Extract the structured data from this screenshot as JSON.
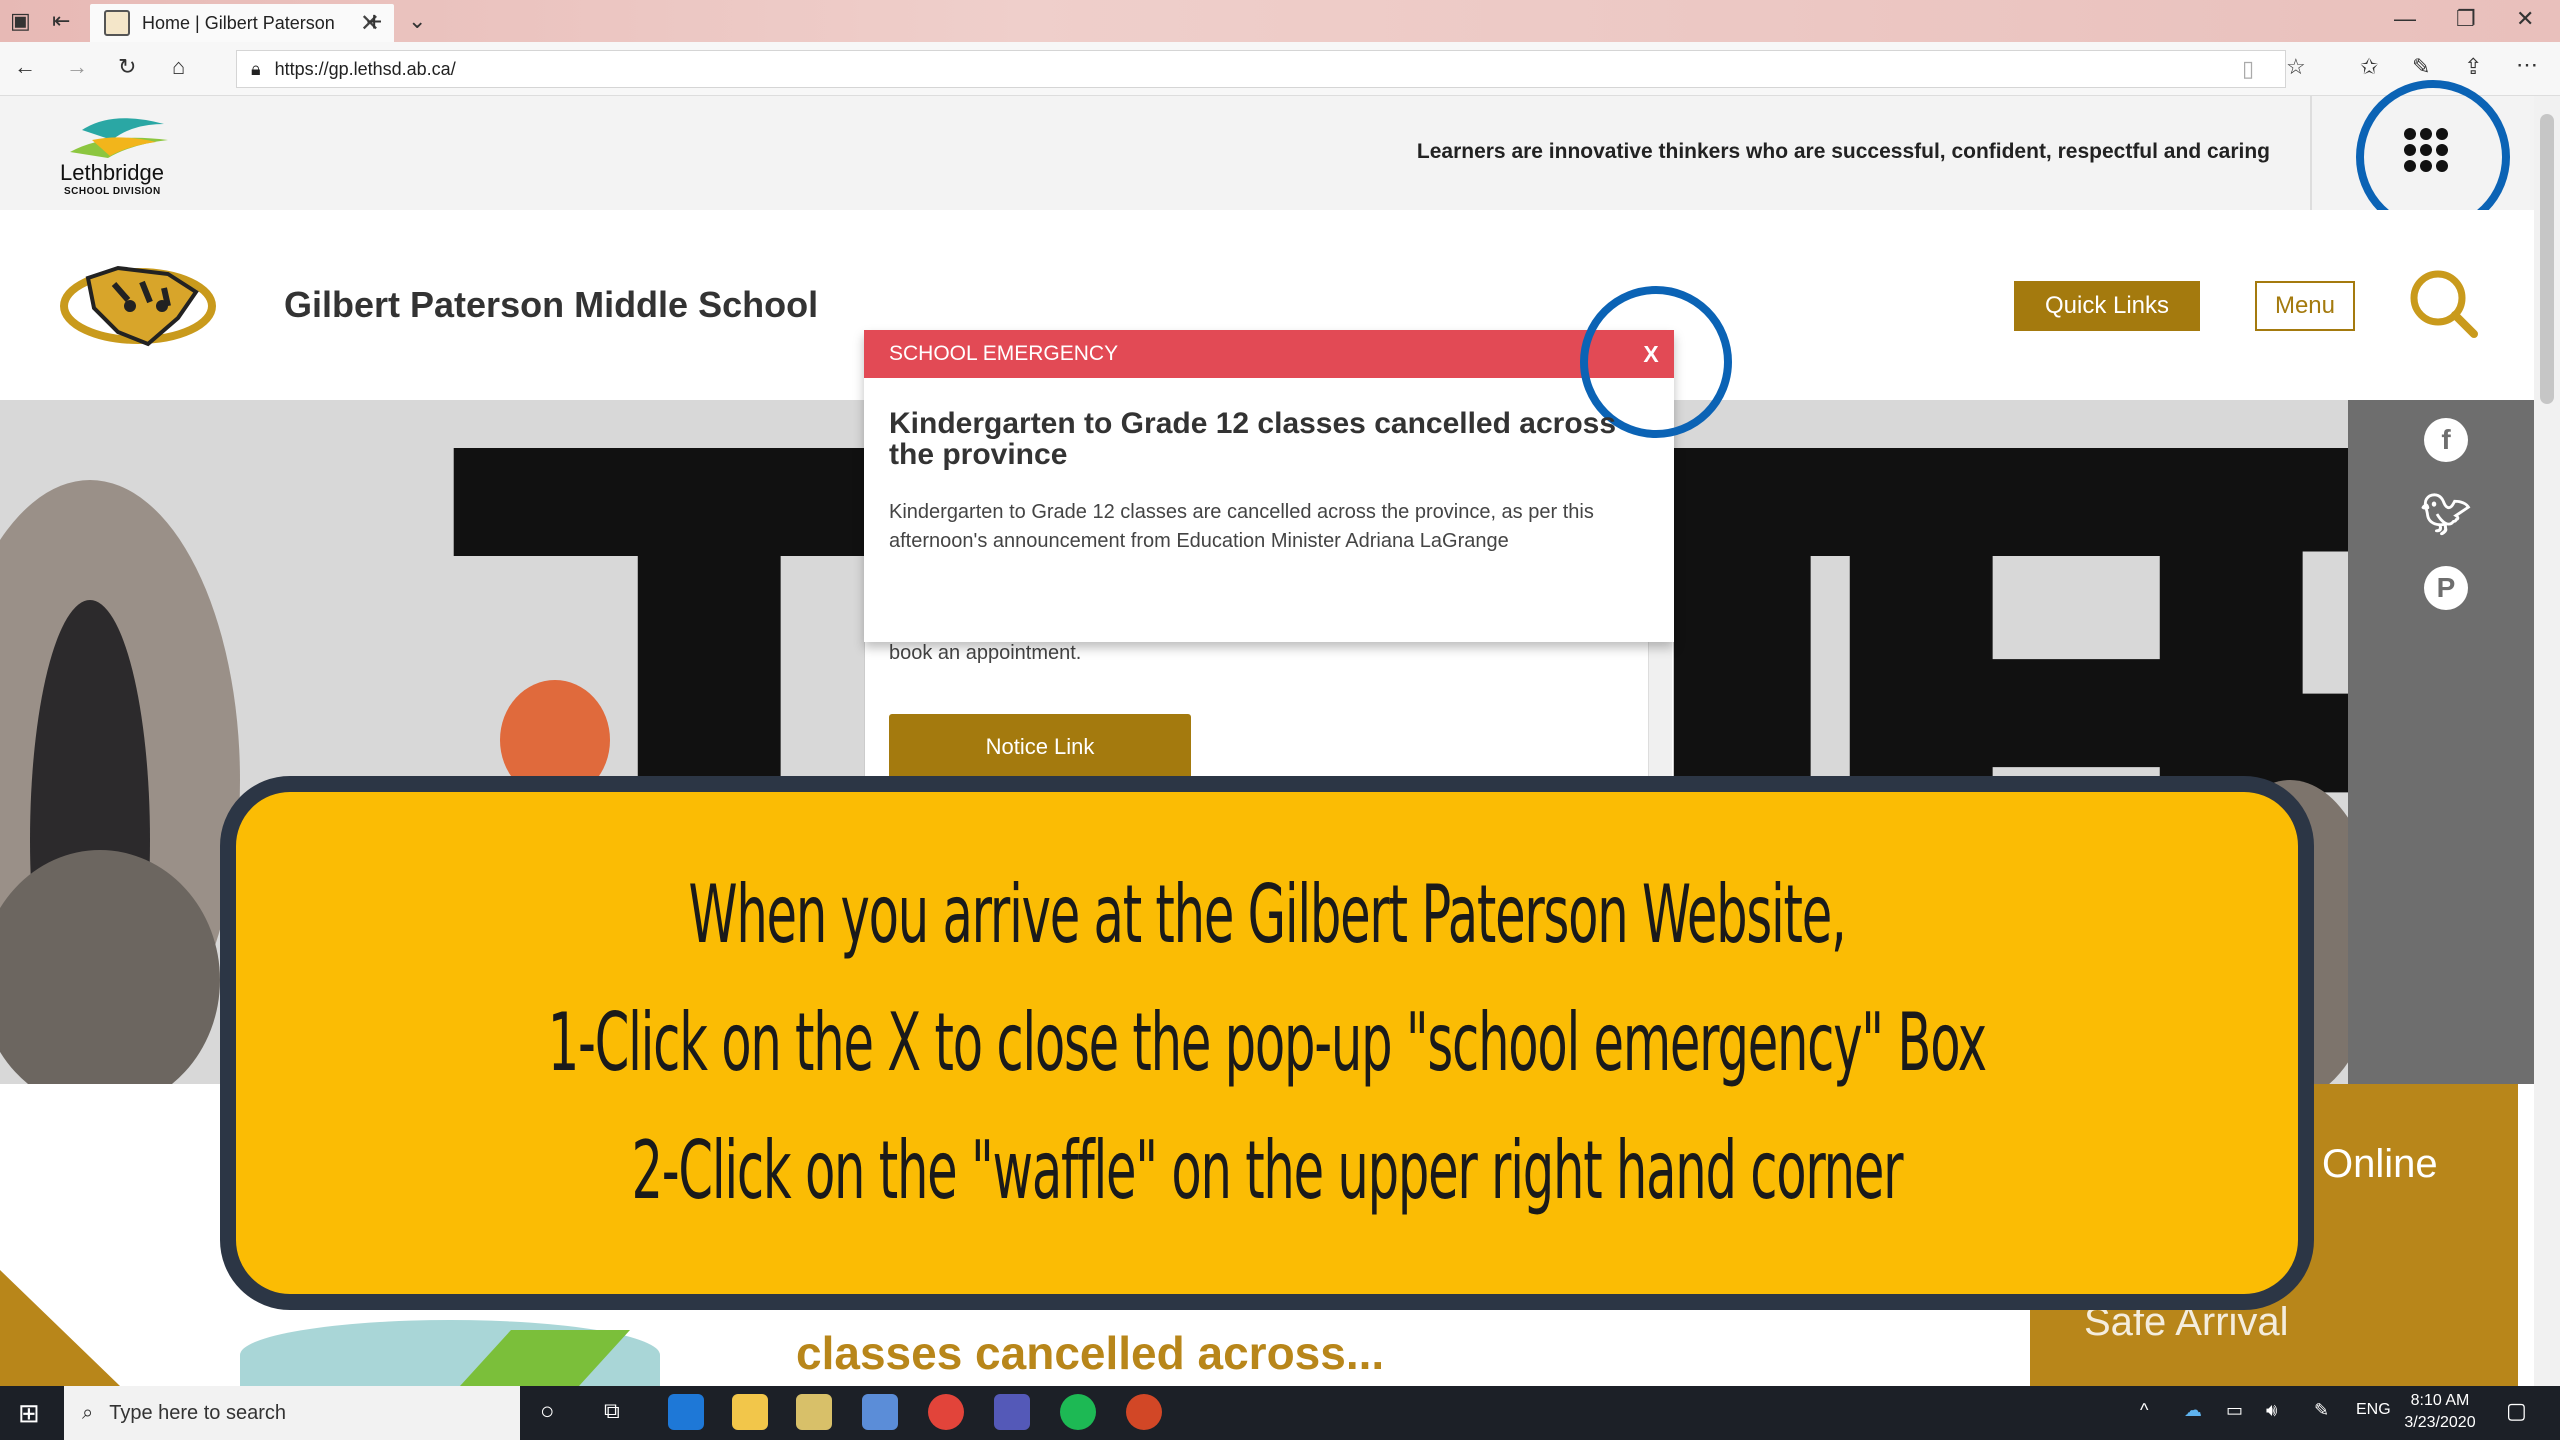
{
  "browser": {
    "tab_title": "Home | Gilbert Paterson",
    "url": "https://gp.lethsd.ab.ca/"
  },
  "site": {
    "division_logo_name": "Lethbridge",
    "division_logo_sub": "SCHOOL DIVISION",
    "tagline": "Learners are innovative thinkers who are successful, confident, respectful and caring",
    "school_name": "Gilbert Paterson Middle School",
    "quick_links": "Quick Links",
    "menu": "Menu",
    "online_label": "Online",
    "safe_arrival_label": "Safe Arrival",
    "news_headline": "classes cancelled across..."
  },
  "modal": {
    "title": "SCHOOL EMERGENCY",
    "close": "X",
    "heading": "Kindergarten to Grade 12 classes cancelled across the province",
    "body": "Kindergarten to Grade 12 classes are cancelled across the province, as per this afternoon's announcement from Education Minister Adriana LaGrange",
    "behind_text": "book an appointment.",
    "notice_link": "Notice Link"
  },
  "instruction": {
    "line1": "When you arrive at the Gilbert Paterson Website,",
    "line2": "1-Click on the X to close the pop-up \"school emergency\" Box",
    "line3": "2-Click on the \"waffle\" on the upper right hand corner"
  },
  "taskbar": {
    "search_placeholder": "Type here to search",
    "lang": "ENG",
    "time": "8:10 AM",
    "date": "3/23/2020"
  },
  "colors": {
    "accent_gold": "#a47a0e",
    "emergency_red": "#e24a55",
    "highlight_ring": "#0b63b5",
    "overlay_yellow": "#fbbc04"
  }
}
